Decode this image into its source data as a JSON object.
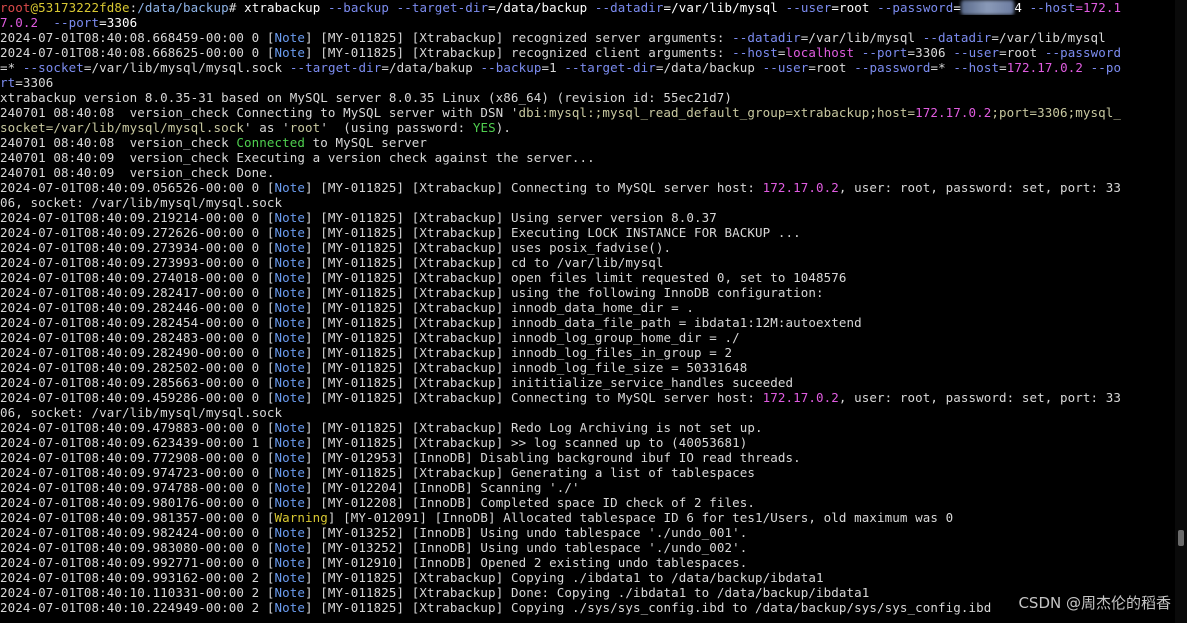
{
  "colors": {
    "background": "#000000",
    "text": "#d8d8d8",
    "prompt_user": "#d94a4a",
    "prompt_host": "#d8c832",
    "path": "#8fb4e8",
    "option": "#7c8cf0",
    "ip_value": "#e05ce0",
    "note_tag": "#6b9cf0",
    "warning_tag": "#d8c832",
    "success": "#4fcf4f"
  },
  "watermark": "CSDN @周杰伦的稻香",
  "lines": [
    [
      {
        "t": "root",
        "c": "user"
      },
      {
        "t": "@53173222fd8e",
        "c": "host"
      },
      {
        "t": ":",
        "c": ""
      },
      {
        "t": "/data/backup",
        "c": "path"
      },
      {
        "t": "# ",
        "c": ""
      },
      {
        "t": "xtrabackup ",
        "c": "cmd"
      },
      {
        "t": "--backup",
        "c": "opt"
      },
      {
        "t": " ",
        "c": ""
      },
      {
        "t": "--target-dir",
        "c": "opt"
      },
      {
        "t": "=/data/backup ",
        "c": "cmd"
      },
      {
        "t": "--datadir",
        "c": "opt"
      },
      {
        "t": "=/var/lib/mysql ",
        "c": "cmd"
      },
      {
        "t": "--user",
        "c": "opt"
      },
      {
        "t": "=root ",
        "c": "cmd"
      },
      {
        "t": "--password",
        "c": "opt"
      },
      {
        "t": "=",
        "c": "cmd"
      },
      {
        "t": "*******",
        "c": "blur"
      },
      {
        "t": "4 ",
        "c": "cmd"
      },
      {
        "t": "--host",
        "c": "opt"
      },
      {
        "t": "=172.1",
        "c": "mag"
      }
    ],
    [
      {
        "t": "7.0.2",
        "c": "mag"
      },
      {
        "t": "  ",
        "c": ""
      },
      {
        "t": "--port",
        "c": "opt"
      },
      {
        "t": "=3306",
        "c": "cmd"
      }
    ],
    [
      {
        "t": "2024-07-01T08:40:08.668459-00:00 0 [",
        "c": ""
      },
      {
        "t": "Note",
        "c": "note"
      },
      {
        "t": "] [MY-011825] [Xtrabackup] recognized server arguments: ",
        "c": ""
      },
      {
        "t": "--datadir",
        "c": "opt"
      },
      {
        "t": "=/var/lib/mysql ",
        "c": ""
      },
      {
        "t": "--datadir",
        "c": "opt"
      },
      {
        "t": "=/var/lib/mysql",
        "c": ""
      }
    ],
    [
      {
        "t": "2024-07-01T08:40:08.668625-00:00 0 [",
        "c": ""
      },
      {
        "t": "Note",
        "c": "note"
      },
      {
        "t": "] [MY-011825] [Xtrabackup] recognized client arguments: ",
        "c": ""
      },
      {
        "t": "--host",
        "c": "opt"
      },
      {
        "t": "=",
        "c": ""
      },
      {
        "t": "localhost",
        "c": "mag"
      },
      {
        "t": " ",
        "c": ""
      },
      {
        "t": "--port",
        "c": "opt"
      },
      {
        "t": "=3306 ",
        "c": ""
      },
      {
        "t": "--user",
        "c": "opt"
      },
      {
        "t": "=root ",
        "c": ""
      },
      {
        "t": "--password",
        "c": "opt"
      }
    ],
    [
      {
        "t": "=* ",
        "c": ""
      },
      {
        "t": "--socket",
        "c": "opt"
      },
      {
        "t": "=/var/lib/mysql/mysql.sock ",
        "c": ""
      },
      {
        "t": "--target-dir",
        "c": "opt"
      },
      {
        "t": "=/data/bakup ",
        "c": ""
      },
      {
        "t": "--backup",
        "c": "opt"
      },
      {
        "t": "=1 ",
        "c": ""
      },
      {
        "t": "--target-dir",
        "c": "opt"
      },
      {
        "t": "=/data/backup ",
        "c": ""
      },
      {
        "t": "--user",
        "c": "opt"
      },
      {
        "t": "=root ",
        "c": ""
      },
      {
        "t": "--password",
        "c": "opt"
      },
      {
        "t": "=* ",
        "c": ""
      },
      {
        "t": "--host",
        "c": "opt"
      },
      {
        "t": "=",
        "c": ""
      },
      {
        "t": "172.17.0.2",
        "c": "mag"
      },
      {
        "t": " ",
        "c": ""
      },
      {
        "t": "--po",
        "c": "opt"
      }
    ],
    [
      {
        "t": "rt",
        "c": "opt"
      },
      {
        "t": "=3306",
        "c": ""
      }
    ],
    [
      {
        "t": "xtrabackup version 8.0.35-31 based on MySQL server 8.0.35 Linux (x86_64) (revision id: 55ec21d7)",
        "c": ""
      }
    ],
    [
      {
        "t": "240701 08:40:08  version_check Connecting to MySQL server with DSN '",
        "c": ""
      },
      {
        "t": "dbi:mysql:;mysql_read_default_group=xtrabackup;host=",
        "c": "str"
      },
      {
        "t": "172.17.0.2",
        "c": "mag"
      },
      {
        "t": ";port=3306;mysql_",
        "c": "str"
      }
    ],
    [
      {
        "t": "socket=/var/lib/mysql/mysql.sock",
        "c": "str"
      },
      {
        "t": "' as '",
        "c": ""
      },
      {
        "t": "root",
        "c": "str"
      },
      {
        "t": "'  (using password: ",
        "c": ""
      },
      {
        "t": "YES",
        "c": "green"
      },
      {
        "t": ").",
        "c": ""
      }
    ],
    [
      {
        "t": "240701 08:40:08  version_check ",
        "c": ""
      },
      {
        "t": "Connected",
        "c": "green"
      },
      {
        "t": " to MySQL server",
        "c": ""
      }
    ],
    [
      {
        "t": "240701 08:40:09  version_check Executing a version check against the server...",
        "c": ""
      }
    ],
    [
      {
        "t": "240701 08:40:09  version_check Done.",
        "c": ""
      }
    ],
    [
      {
        "t": "2024-07-01T08:40:09.056526-00:00 0 [",
        "c": ""
      },
      {
        "t": "Note",
        "c": "note"
      },
      {
        "t": "] [MY-011825] [Xtrabackup] Connecting to MySQL server host: ",
        "c": ""
      },
      {
        "t": "172.17.0.2",
        "c": "mag"
      },
      {
        "t": ", user: root, password: set, port: 33",
        "c": ""
      }
    ],
    [
      {
        "t": "06, socket: /var/lib/mysql/mysql.sock",
        "c": ""
      }
    ],
    [
      {
        "t": "2024-07-01T08:40:09.219214-00:00 0 [",
        "c": ""
      },
      {
        "t": "Note",
        "c": "note"
      },
      {
        "t": "] [MY-011825] [Xtrabackup] Using server version 8.0.37",
        "c": ""
      }
    ],
    [
      {
        "t": "2024-07-01T08:40:09.272626-00:00 0 [",
        "c": ""
      },
      {
        "t": "Note",
        "c": "note"
      },
      {
        "t": "] [MY-011825] [Xtrabackup] Executing LOCK INSTANCE FOR BACKUP ...",
        "c": ""
      }
    ],
    [
      {
        "t": "2024-07-01T08:40:09.273934-00:00 0 [",
        "c": ""
      },
      {
        "t": "Note",
        "c": "note"
      },
      {
        "t": "] [MY-011825] [Xtrabackup] uses posix_fadvise().",
        "c": ""
      }
    ],
    [
      {
        "t": "2024-07-01T08:40:09.273993-00:00 0 [",
        "c": ""
      },
      {
        "t": "Note",
        "c": "note"
      },
      {
        "t": "] [MY-011825] [Xtrabackup] cd to /var/lib/mysql",
        "c": ""
      }
    ],
    [
      {
        "t": "2024-07-01T08:40:09.274018-00:00 0 [",
        "c": ""
      },
      {
        "t": "Note",
        "c": "note"
      },
      {
        "t": "] [MY-011825] [Xtrabackup] open files limit requested 0, set to 1048576",
        "c": ""
      }
    ],
    [
      {
        "t": "2024-07-01T08:40:09.282417-00:00 0 [",
        "c": ""
      },
      {
        "t": "Note",
        "c": "note"
      },
      {
        "t": "] [MY-011825] [Xtrabackup] using the following InnoDB configuration:",
        "c": ""
      }
    ],
    [
      {
        "t": "2024-07-01T08:40:09.282446-00:00 0 [",
        "c": ""
      },
      {
        "t": "Note",
        "c": "note"
      },
      {
        "t": "] [MY-011825] [Xtrabackup] innodb_data_home_dir = .",
        "c": ""
      }
    ],
    [
      {
        "t": "2024-07-01T08:40:09.282454-00:00 0 [",
        "c": ""
      },
      {
        "t": "Note",
        "c": "note"
      },
      {
        "t": "] [MY-011825] [Xtrabackup] innodb_data_file_path = ibdata1:12M:autoextend",
        "c": ""
      }
    ],
    [
      {
        "t": "2024-07-01T08:40:09.282483-00:00 0 [",
        "c": ""
      },
      {
        "t": "Note",
        "c": "note"
      },
      {
        "t": "] [MY-011825] [Xtrabackup] innodb_log_group_home_dir = ./",
        "c": ""
      }
    ],
    [
      {
        "t": "2024-07-01T08:40:09.282490-00:00 0 [",
        "c": ""
      },
      {
        "t": "Note",
        "c": "note"
      },
      {
        "t": "] [MY-011825] [Xtrabackup] innodb_log_files_in_group = 2",
        "c": ""
      }
    ],
    [
      {
        "t": "2024-07-01T08:40:09.282502-00:00 0 [",
        "c": ""
      },
      {
        "t": "Note",
        "c": "note"
      },
      {
        "t": "] [MY-011825] [Xtrabackup] innodb_log_file_size = 50331648",
        "c": ""
      }
    ],
    [
      {
        "t": "2024-07-01T08:40:09.285663-00:00 0 [",
        "c": ""
      },
      {
        "t": "Note",
        "c": "note"
      },
      {
        "t": "] [MY-011825] [Xtrabackup] inititialize_service_handles suceeded",
        "c": ""
      }
    ],
    [
      {
        "t": "2024-07-01T08:40:09.459286-00:00 0 [",
        "c": ""
      },
      {
        "t": "Note",
        "c": "note"
      },
      {
        "t": "] [MY-011825] [Xtrabackup] Connecting to MySQL server host: ",
        "c": ""
      },
      {
        "t": "172.17.0.2",
        "c": "mag"
      },
      {
        "t": ", user: root, password: set, port: 33",
        "c": ""
      }
    ],
    [
      {
        "t": "06, socket: /var/lib/mysql/mysql.sock",
        "c": ""
      }
    ],
    [
      {
        "t": "2024-07-01T08:40:09.479883-00:00 0 [",
        "c": ""
      },
      {
        "t": "Note",
        "c": "note"
      },
      {
        "t": "] [MY-011825] [Xtrabackup] Redo Log Archiving is not set up.",
        "c": ""
      }
    ],
    [
      {
        "t": "2024-07-01T08:40:09.623439-00:00 1 [",
        "c": ""
      },
      {
        "t": "Note",
        "c": "note"
      },
      {
        "t": "] [MY-011825] [Xtrabackup] >> log scanned up to (40053681)",
        "c": ""
      }
    ],
    [
      {
        "t": "2024-07-01T08:40:09.772908-00:00 0 [",
        "c": ""
      },
      {
        "t": "Note",
        "c": "note"
      },
      {
        "t": "] [MY-012953] [InnoDB] Disabling background ibuf IO read threads.",
        "c": ""
      }
    ],
    [
      {
        "t": "2024-07-01T08:40:09.974723-00:00 0 [",
        "c": ""
      },
      {
        "t": "Note",
        "c": "note"
      },
      {
        "t": "] [MY-011825] [Xtrabackup] Generating a list of tablespaces",
        "c": ""
      }
    ],
    [
      {
        "t": "2024-07-01T08:40:09.974788-00:00 0 [",
        "c": ""
      },
      {
        "t": "Note",
        "c": "note"
      },
      {
        "t": "] [MY-012204] [InnoDB] Scanning './'",
        "c": ""
      }
    ],
    [
      {
        "t": "2024-07-01T08:40:09.980176-00:00 0 [",
        "c": ""
      },
      {
        "t": "Note",
        "c": "note"
      },
      {
        "t": "] [MY-012208] [InnoDB] Completed space ID check of 2 files.",
        "c": ""
      }
    ],
    [
      {
        "t": "2024-07-01T08:40:09.981357-00:00 0 [",
        "c": ""
      },
      {
        "t": "Warning",
        "c": "warn"
      },
      {
        "t": "] [MY-012091] [InnoDB] Allocated tablespace ID 6 for tes1/Users, old maximum was 0",
        "c": ""
      }
    ],
    [
      {
        "t": "2024-07-01T08:40:09.982424-00:00 0 [",
        "c": ""
      },
      {
        "t": "Note",
        "c": "note"
      },
      {
        "t": "] [MY-013252] [InnoDB] Using undo tablespace './undo_001'.",
        "c": ""
      }
    ],
    [
      {
        "t": "2024-07-01T08:40:09.983080-00:00 0 [",
        "c": ""
      },
      {
        "t": "Note",
        "c": "note"
      },
      {
        "t": "] [MY-013252] [InnoDB] Using undo tablespace './undo_002'.",
        "c": ""
      }
    ],
    [
      {
        "t": "2024-07-01T08:40:09.992771-00:00 0 [",
        "c": ""
      },
      {
        "t": "Note",
        "c": "note"
      },
      {
        "t": "] [MY-012910] [InnoDB] Opened 2 existing undo tablespaces.",
        "c": ""
      }
    ],
    [
      {
        "t": "2024-07-01T08:40:09.993162-00:00 2 [",
        "c": ""
      },
      {
        "t": "Note",
        "c": "note"
      },
      {
        "t": "] [MY-011825] [Xtrabackup] Copying ./ibdata1 to /data/backup/ibdata1",
        "c": ""
      }
    ],
    [
      {
        "t": "2024-07-01T08:40:10.110331-00:00 2 [",
        "c": ""
      },
      {
        "t": "Note",
        "c": "note"
      },
      {
        "t": "] [MY-011825] [Xtrabackup] Done: Copying ./ibdata1 to /data/backup/ibdata1",
        "c": ""
      }
    ],
    [
      {
        "t": "2024-07-01T08:40:10.224949-00:00 2 [",
        "c": ""
      },
      {
        "t": "Note",
        "c": "note"
      },
      {
        "t": "] [MY-011825] [Xtrabackup] Copying ./sys/sys_config.ibd to /data/backup/sys/sys_config.ibd",
        "c": ""
      }
    ]
  ]
}
